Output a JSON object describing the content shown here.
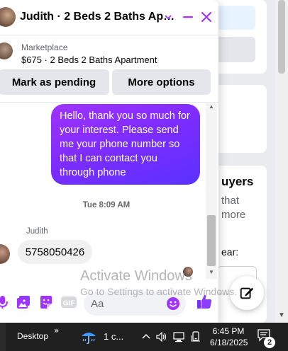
{
  "background": {
    "section_title": "uyers",
    "line1": "that",
    "line2": "more",
    "line3": "ear:"
  },
  "chat": {
    "title": "Judith · 2 Beds 2 Baths Ap…",
    "listing": {
      "label": "Marketplace",
      "title": "$675 · 2 Beds 2 Baths Apartment"
    },
    "actions": {
      "mark_pending": "Mark as pending",
      "more_options": "More options"
    },
    "messages": [
      {
        "direction": "outgoing",
        "text": "Hello, thank you so much for your interest. Please send me your phone number so that I can contact you through phone"
      },
      {
        "direction": "incoming",
        "sender": "Judith",
        "text": "5758050426"
      }
    ],
    "timestamp": "Tue 8:09 AM",
    "composer": {
      "placeholder": "Aa"
    },
    "accent_color": "#a033ff"
  },
  "watermark": {
    "title": "Activate Windows",
    "subtitle": "Go to Settings to activate Windows."
  },
  "taskbar": {
    "desktop_label": "Desktop",
    "chevron": "»",
    "weather": "1 c...",
    "time": "6:45 PM",
    "date": "6/18/2025",
    "notification_count": "2"
  }
}
